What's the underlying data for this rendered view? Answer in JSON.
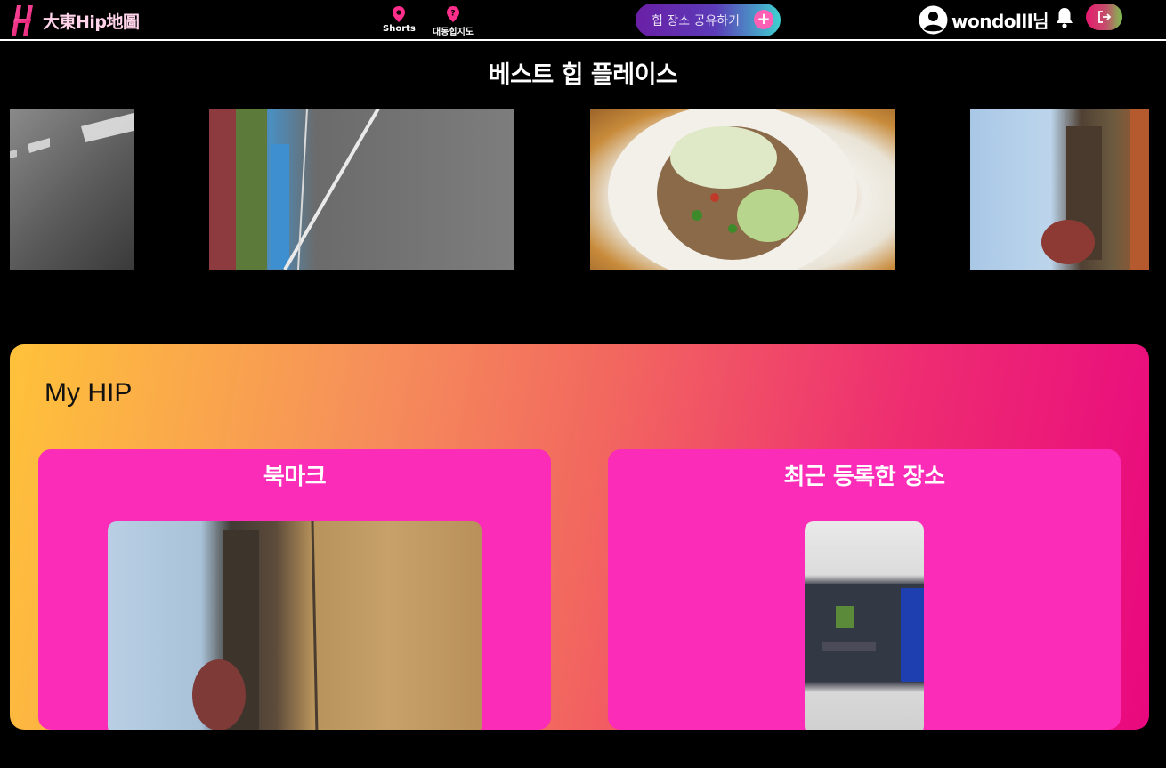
{
  "header": {
    "logo_text": "大東Hip地圖",
    "nav": [
      {
        "label": "Shorts",
        "icon": "map-pin-icon"
      },
      {
        "label": "대동힙지도",
        "icon": "question-pin-icon"
      }
    ],
    "share_button_label": "힙 장소 공유하기",
    "share_button_icon": "+",
    "username": "wondolll님",
    "colors": {
      "accent_pink": "#ff2e8a",
      "share_start": "#6a1fa6",
      "share_end": "#3fd0d0"
    }
  },
  "best": {
    "title": "베스트 힙 플레이스"
  },
  "myhip": {
    "title": "My HIP",
    "cards": [
      {
        "title": "북마크"
      },
      {
        "title": "최근 등록한 장소"
      }
    ],
    "colors": {
      "card_bg": "#fb2cb7",
      "gradient_start": "#ffc23a",
      "gradient_end": "#e9087f"
    }
  }
}
